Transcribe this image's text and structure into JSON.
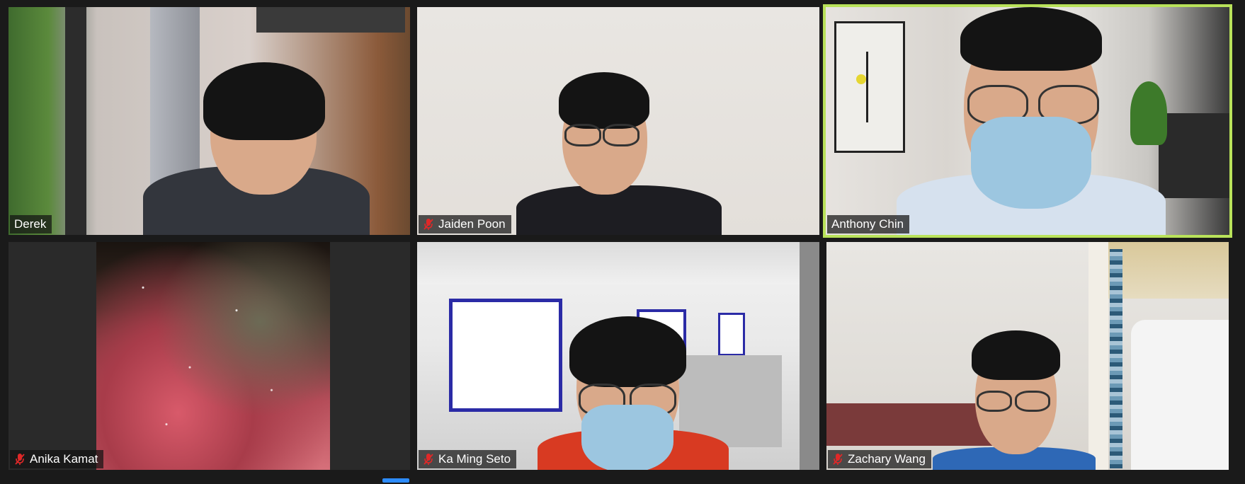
{
  "participants": [
    {
      "name": "Derek",
      "muted": false,
      "active_speaker": false
    },
    {
      "name": "Jaiden Poon",
      "muted": true,
      "active_speaker": false
    },
    {
      "name": "Anthony Chin",
      "muted": false,
      "active_speaker": true
    },
    {
      "name": "Anika Kamat",
      "muted": true,
      "active_speaker": false
    },
    {
      "name": "Ka Ming Seto",
      "muted": true,
      "active_speaker": false
    },
    {
      "name": "Zachary Wang",
      "muted": true,
      "active_speaker": false
    }
  ],
  "icons": {
    "mute": "microphone-muted-icon"
  },
  "colors": {
    "active_speaker_border": "#b9e25a",
    "muted_icon": "#e02828",
    "name_tag_bg": "#141414",
    "background": "#1a1a1a"
  }
}
